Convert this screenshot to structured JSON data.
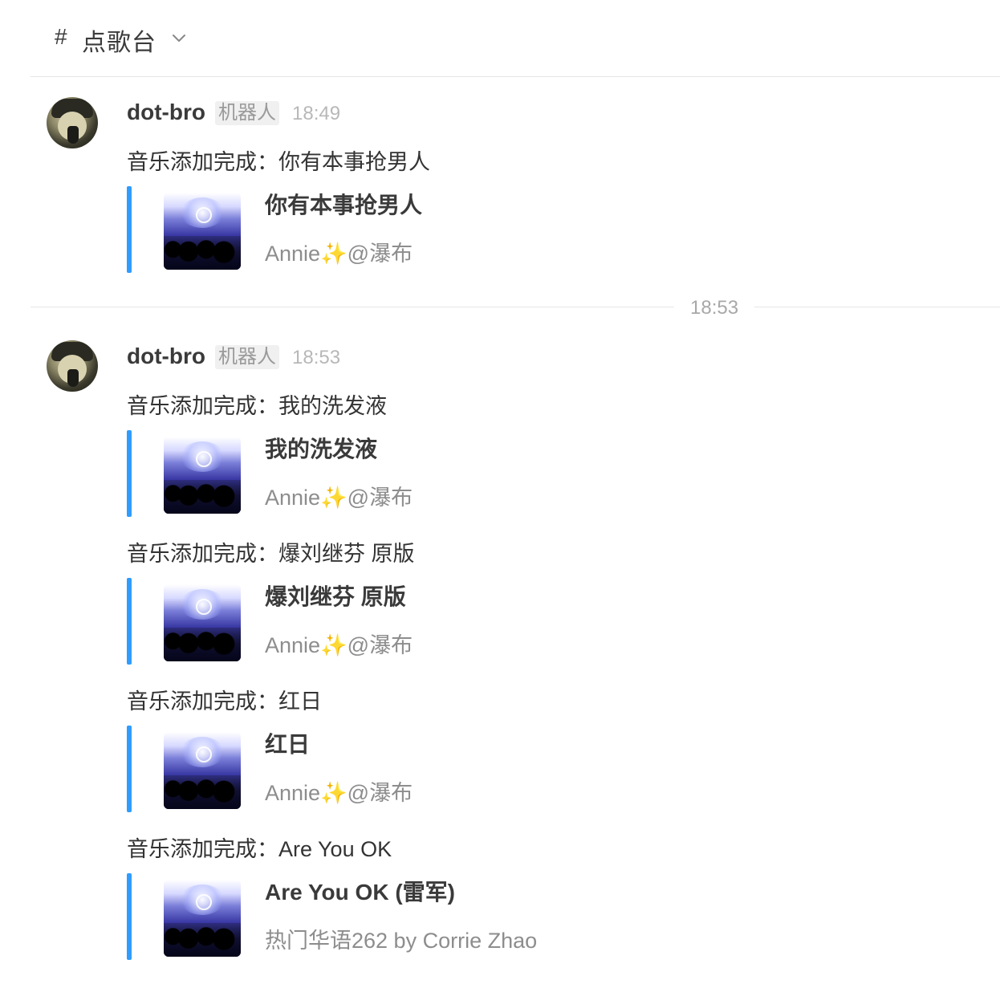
{
  "channel": {
    "hash": "#",
    "name": "点歌台"
  },
  "divider": {
    "time": "18:53"
  },
  "messages": [
    {
      "author": "dot-bro",
      "badge": "机器人",
      "time": "18:49",
      "entries": [
        {
          "text": "音乐添加完成：你有本事抢男人",
          "song": {
            "title": "你有本事抢男人",
            "artist": "Annie✨@瀑布"
          }
        }
      ]
    },
    {
      "author": "dot-bro",
      "badge": "机器人",
      "time": "18:53",
      "entries": [
        {
          "text": "音乐添加完成：我的洗发液",
          "song": {
            "title": "我的洗发液",
            "artist": "Annie✨@瀑布"
          }
        },
        {
          "text": "音乐添加完成：爆刘继芬 原版",
          "song": {
            "title": "爆刘继芬 原版",
            "artist": "Annie✨@瀑布"
          }
        },
        {
          "text": "音乐添加完成：红日",
          "song": {
            "title": "红日",
            "artist": "Annie✨@瀑布"
          }
        },
        {
          "text": "音乐添加完成：Are You OK",
          "song": {
            "title": "Are You OK (雷军)",
            "artist": "热门华语262 by Corrie Zhao"
          }
        }
      ]
    }
  ],
  "colors": {
    "accent_bar": "#2f9cff",
    "muted": "#8d8d8d",
    "divider": "#e6e6e6"
  },
  "icons": {
    "chevron": "chevron-down-icon"
  }
}
